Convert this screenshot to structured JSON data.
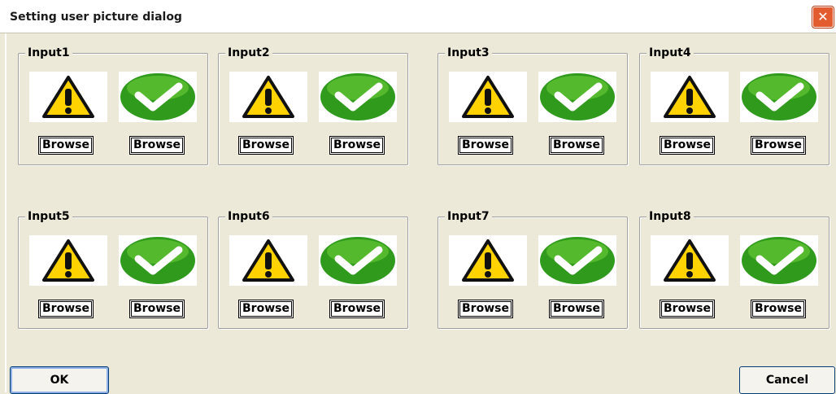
{
  "window": {
    "title": "Setting user picture dialog",
    "close_glyph": "✕"
  },
  "groups": [
    {
      "label": "Input1",
      "left_icon": "warning-icon",
      "right_icon": "check-icon",
      "browse_left": "Browse",
      "browse_right": "Browse"
    },
    {
      "label": "Input2",
      "left_icon": "warning-icon",
      "right_icon": "check-icon",
      "browse_left": "Browse",
      "browse_right": "Browse"
    },
    {
      "label": "Input3",
      "left_icon": "warning-icon",
      "right_icon": "check-icon",
      "browse_left": "Browse",
      "browse_right": "Browse"
    },
    {
      "label": "Input4",
      "left_icon": "warning-icon",
      "right_icon": "check-icon",
      "browse_left": "Browse",
      "browse_right": "Browse"
    },
    {
      "label": "Input5",
      "left_icon": "warning-icon",
      "right_icon": "check-icon",
      "browse_left": "Browse",
      "browse_right": "Browse"
    },
    {
      "label": "Input6",
      "left_icon": "warning-icon",
      "right_icon": "check-icon",
      "browse_left": "Browse",
      "browse_right": "Browse"
    },
    {
      "label": "Input7",
      "left_icon": "warning-icon",
      "right_icon": "check-icon",
      "browse_left": "Browse",
      "browse_right": "Browse"
    },
    {
      "label": "Input8",
      "left_icon": "warning-icon",
      "right_icon": "check-icon",
      "browse_left": "Browse",
      "browse_right": "Browse"
    }
  ],
  "buttons": {
    "ok": "OK",
    "cancel": "Cancel"
  },
  "colors": {
    "dialog_bg": "#ece9d8",
    "warning_yellow": "#ffd200",
    "check_green": "#2f9a1c"
  }
}
